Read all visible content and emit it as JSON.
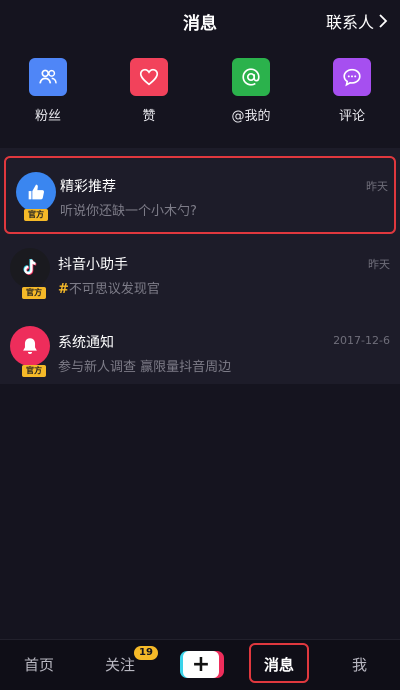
{
  "header": {
    "title": "消息",
    "contacts_label": "联系人"
  },
  "quick_actions": [
    {
      "label": "粉丝",
      "icon": "fans-icon",
      "color": "#4f86f7"
    },
    {
      "label": "赞",
      "icon": "heart-icon",
      "color": "#f2425b"
    },
    {
      "label": "@我的",
      "icon": "at-icon",
      "color": "#2bb24c"
    },
    {
      "label": "评论",
      "icon": "comment-icon",
      "color": "#a64ff0"
    }
  ],
  "messages": [
    {
      "name": "精彩推荐",
      "preview": "听说你还缺一个小木勺?",
      "time": "昨天",
      "badge": "官方",
      "avatar_icon": "thumbs-up-icon",
      "avatar_color": "#3a86f0"
    },
    {
      "name": "抖音小助手",
      "preview_hash": "#",
      "preview": "不可思议发现官",
      "time": "昨天",
      "badge": "官方",
      "avatar_icon": "tiktok-icon",
      "avatar_color": "#1a1a1f"
    },
    {
      "name": "系统通知",
      "preview": "参与新人调查 赢限量抖音周边",
      "time": "2017-12-6",
      "badge": "官方",
      "avatar_icon": "bell-icon",
      "avatar_color": "#ee2d5b"
    }
  ],
  "tabbar": {
    "home": "首页",
    "follow": "关注",
    "follow_count": "19",
    "plus": "+",
    "messages": "消息",
    "me": "我"
  }
}
